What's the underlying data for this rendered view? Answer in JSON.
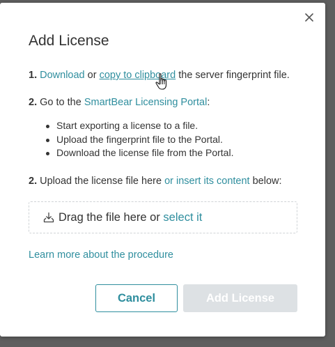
{
  "dialog": {
    "title": "Add License",
    "close_icon": "close-icon"
  },
  "step1": {
    "number": "1.",
    "download_link": "Download",
    "or_text": " or ",
    "copy_link": "copy to clipboard",
    "suffix": " the server fingerprint file."
  },
  "step2": {
    "number": "2.",
    "prefix": " Go to the ",
    "portal_link": "SmartBear Licensing Portal",
    "suffix": ":",
    "bullets": [
      "Start exporting a license to a file.",
      "Upload the fingerprint file to the Portal.",
      "Download the license file from the Portal."
    ]
  },
  "step3": {
    "number": "2.",
    "prefix": " Upload the license file here ",
    "insert_link": "or insert its content",
    "suffix": " below:"
  },
  "dropzone": {
    "icon": "upload-tray-icon",
    "text": "Drag the file here or ",
    "select_link": "select it"
  },
  "learn_more": "Learn more about the procedure",
  "buttons": {
    "cancel": "Cancel",
    "add_license": "Add License"
  },
  "colors": {
    "accent": "#2f8e9e",
    "disabled_button": "#dde1e4",
    "text": "#333333",
    "backdrop": "#5f5f5f"
  }
}
